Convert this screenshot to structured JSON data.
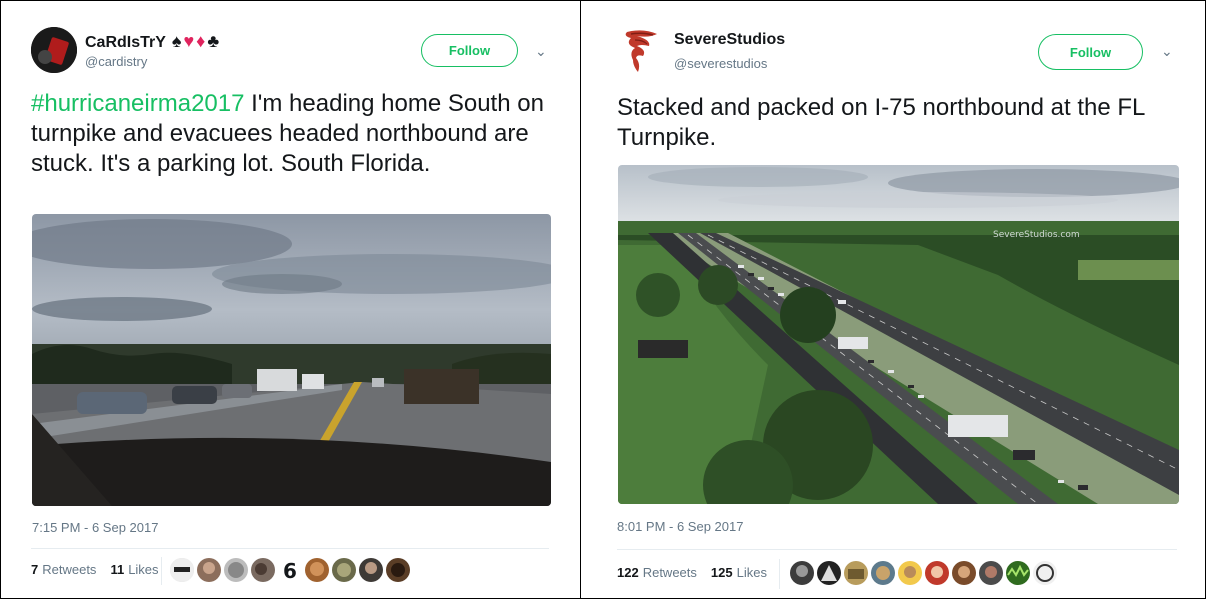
{
  "tweets": [
    {
      "name": "CaRdIsTrY",
      "name_suits": "♠♥♦♣",
      "handle": "@cardistry",
      "follow_label": "Follow",
      "hashtag": "#hurricaneirma2017",
      "text": " I'm heading home South on turnpike and evacuees headed northbound are stuck. It's a parking lot. South Florida.",
      "time": "7:15 PM - 6 Sep 2017",
      "retweets_count": "7",
      "retweets_label": "Retweets",
      "likes_count": "11",
      "likes_label": "Likes",
      "likers": 9
    },
    {
      "name": "SevereStudios",
      "handle": "@severestudios",
      "follow_label": "Follow",
      "text": "Stacked and packed on I-75 northbound at the FL Turnpike.",
      "media_watermark": "SevereStudios.com",
      "time": "8:01 PM - 6 Sep 2017",
      "retweets_count": "122",
      "retweets_label": "Retweets",
      "likes_count": "125",
      "likes_label": "Likes",
      "likers": 10
    }
  ],
  "colors": {
    "accent": "#17bf63",
    "muted": "#657786",
    "text": "#14171a"
  }
}
